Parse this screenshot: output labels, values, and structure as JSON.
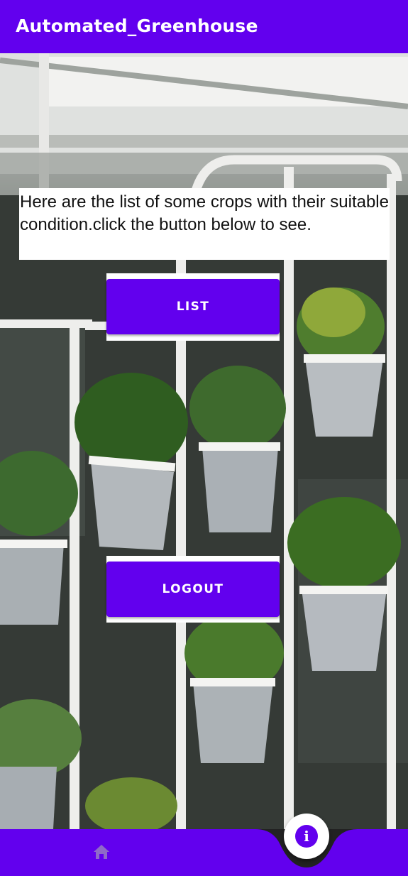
{
  "app_bar": {
    "title": "Automated_Greenhouse"
  },
  "intro": {
    "text": "Here are the list of some crops with their suitable condition.click the button below to see."
  },
  "buttons": {
    "list_label": "LIST",
    "logout_label": "LOGOUT"
  },
  "bottom_nav": {
    "home_icon": "home-icon",
    "fab_icon": "info-icon"
  },
  "colors": {
    "primary": "#6200ee",
    "surface": "#ffffff"
  }
}
